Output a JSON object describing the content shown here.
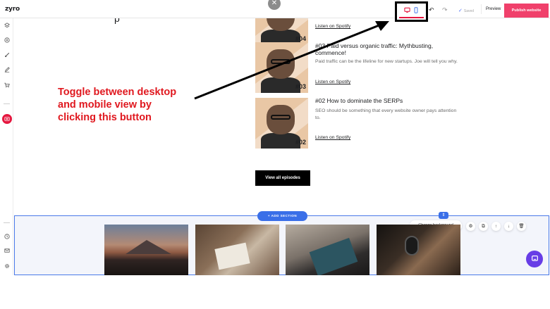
{
  "topbar": {
    "logo": "zyro",
    "close_symbol": "✕",
    "saved_label": "Saved",
    "preview_label": "Preview",
    "publish_label": "Publish website"
  },
  "content": {
    "stray_text": "p"
  },
  "episodes": [
    {
      "number": "#04",
      "title": "",
      "description": "",
      "link": "Listen on Spotify"
    },
    {
      "number": "#03",
      "title": "#03 Paid versus organic traffic: Mythbusting, commence!",
      "description": "Paid traffic can be the lifeline for new startups. Joe will tell you why.",
      "link": "Listen on Spotify"
    },
    {
      "number": "#02",
      "title": "#02 How to dominate the SERPs",
      "description": "SEO should be something that every website owner pays attention to.",
      "link": "Listen on Spotify"
    }
  ],
  "view_all_label": "View all episodes",
  "section_toolbar": {
    "add_section_label": "+ ADD SECTION",
    "change_background_label": "Change background"
  },
  "annotation": {
    "text": "Toggle between desktop and mobile view by clicking this button",
    "color": "#e0181f"
  },
  "colors": {
    "accent": "#e5173f",
    "publish": "#f0406b",
    "edit_blue": "#3a6fe8",
    "chat": "#673de6"
  },
  "icons": {
    "sidebar": [
      "layers-icon",
      "add-circle-icon",
      "brush-icon",
      "pen-icon",
      "cart-icon",
      "podcast-icon",
      "help-icon",
      "mail-icon",
      "settings-icon"
    ],
    "section_controls": [
      "gear-icon",
      "duplicate-icon",
      "arrow-up-icon",
      "arrow-down-icon",
      "trash-icon"
    ]
  }
}
